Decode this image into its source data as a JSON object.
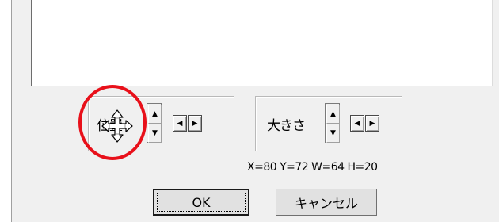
{
  "position_group": {
    "label": "位置",
    "up_arrow": "▲",
    "down_arrow": "▼",
    "left_arrow": "◀",
    "right_arrow": "▶"
  },
  "size_group": {
    "label": "大きさ",
    "up_arrow": "▲",
    "down_arrow": "▼",
    "left_arrow": "◀",
    "right_arrow": "▶"
  },
  "readout": "X=80 Y=72 W=64 H=20",
  "buttons": {
    "ok": "OK",
    "cancel": "キャンセル"
  },
  "annotation": {
    "color": "#e8101a",
    "icon": "move-cursor-icon"
  }
}
